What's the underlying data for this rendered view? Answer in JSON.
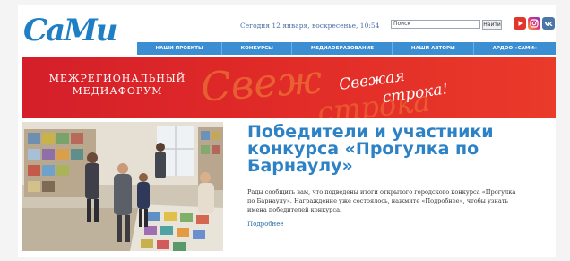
{
  "header": {
    "logo": "СаМи",
    "date": "Сегодня 12 января, воскресенье, 10:54",
    "search": {
      "value": "Поиск",
      "button": "Найти"
    },
    "social": [
      "youtube-icon",
      "instagram-icon",
      "vk-icon"
    ]
  },
  "nav": {
    "items": [
      "НАШИ ПРОЕКТЫ",
      "КОНКУРСЫ",
      "МЕДИАОБРАЗОВАНИЕ",
      "НАШИ АВТОРЫ",
      "АРДОО «САМИ»"
    ]
  },
  "banner": {
    "title_line1": "МЕЖРЕГИОНАЛЬНЫЙ",
    "title_line2": "МЕДИАФОРУМ",
    "slogan_line1": "Свежая",
    "slogan_line2": "строка!"
  },
  "article": {
    "title": "Победители и участники конкурса «Прогулка по Барнаулу»",
    "text": "Рады сообщить вам, что подведены итоги открытого городского конкурса «Прогулка по Барнаулу». Награждение уже состоялось, нажмите «Подробнее», чтобы узнать имена победителей конкурса.",
    "more": "Подробнее"
  },
  "colors": {
    "brand_blue": "#2d82c6",
    "nav_blue": "#3b8ed2",
    "banner_red": "#e02a28"
  }
}
